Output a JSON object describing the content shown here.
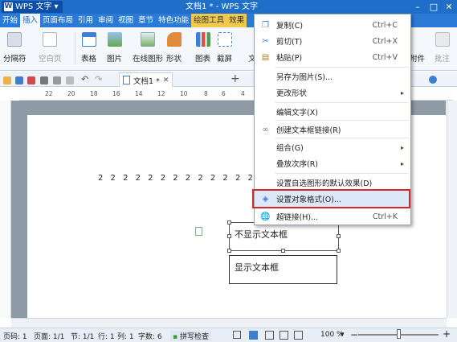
{
  "app": {
    "name": "WPS 文字",
    "logo_letter": "W",
    "title": "文档1 * - WPS 文字"
  },
  "menubar": [
    "开始",
    "插入",
    "页面布局",
    "引用",
    "审阅",
    "视图",
    "章节",
    "特色功能",
    "绘图工具",
    "效果"
  ],
  "ribbon": {
    "buttons": [
      "分隔符",
      "空白页",
      "表格",
      "图片",
      "在线图形",
      "形状",
      "图表",
      "截屏",
      "文",
      "附件",
      "批注"
    ]
  },
  "doc_tab": {
    "label": "文档1 *"
  },
  "ruler_numbers": [
    "22",
    "20",
    "18",
    "16",
    "14",
    "12",
    "10",
    "8",
    "6",
    "4",
    "2"
  ],
  "document": {
    "text_line": "2 2 2 2 2 2 2 2 2 2 2 2 2 2 2",
    "textbox1": "不显示文本框",
    "textbox2": "显示文本框"
  },
  "context_menu": {
    "items": [
      {
        "label": "复制(C)",
        "shortcut": "Ctrl+C",
        "icon": "copy-icon"
      },
      {
        "label": "剪切(T)",
        "shortcut": "Ctrl+X",
        "icon": "scissors-icon"
      },
      {
        "label": "粘贴(P)",
        "shortcut": "Ctrl+V",
        "icon": "paste-icon"
      },
      {
        "label": "另存为图片(S)...",
        "shortcut": "",
        "icon": ""
      },
      {
        "label": "更改形状",
        "shortcut": "",
        "icon": ""
      },
      {
        "label": "编辑文字(X)",
        "shortcut": "",
        "icon": ""
      },
      {
        "label": "创建文本框链接(R)",
        "shortcut": "",
        "icon": "link-icon"
      },
      {
        "label": "组合(G)",
        "shortcut": "",
        "icon": ""
      },
      {
        "label": "叠放次序(R)",
        "shortcut": "",
        "icon": ""
      },
      {
        "label": "设置自选图形的默认效果(D)",
        "shortcut": "",
        "icon": ""
      },
      {
        "label": "设置对象格式(O)...",
        "shortcut": "",
        "icon": "format-object-icon"
      },
      {
        "label": "超链接(H)...",
        "shortcut": "Ctrl+K",
        "icon": "hyperlink-icon"
      }
    ]
  },
  "statusbar": {
    "page": "页码: 1",
    "pages": "页面: 1/1",
    "section": "节: 1/1",
    "row": "行: 1",
    "col": "列: 1",
    "words": "字数: 6",
    "spell": "拼写检查",
    "zoom": "100 %",
    "zoom_minus": "−",
    "zoom_plus": "+"
  },
  "colors": {
    "title_blue": "#1f6fc9",
    "menu_blue": "#2a7ad6",
    "highlight_red": "#d9262e"
  }
}
